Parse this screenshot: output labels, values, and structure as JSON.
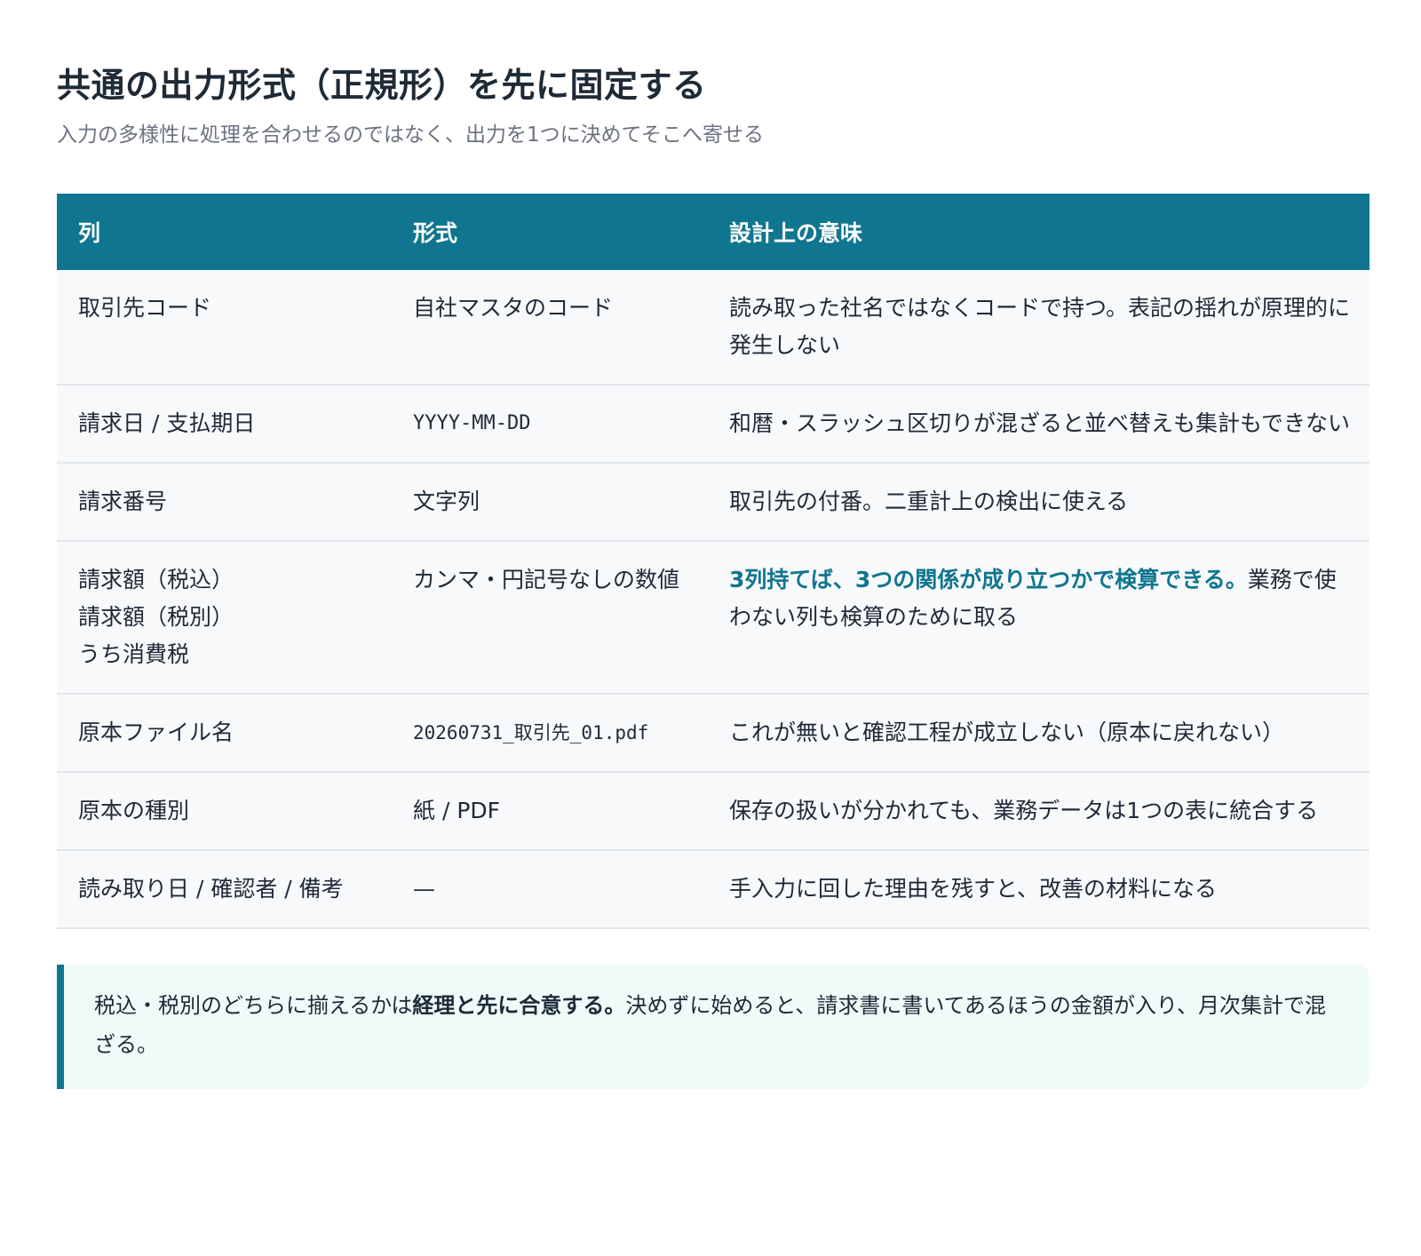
{
  "header": {
    "title": "共通の出力形式（正規形）を先に固定する",
    "subtitle": "入力の多様性に処理を合わせるのではなく、出力を1つに決めてそこへ寄せる"
  },
  "table": {
    "columns": [
      "列",
      "形式",
      "設計上の意味"
    ],
    "rows": [
      {
        "col": [
          "取引先コード"
        ],
        "format": "自社マスタのコード",
        "meaning_accent": "",
        "meaning": "読み取った社名ではなくコードで持つ。表記の揺れが原理的に発生しない"
      },
      {
        "col": [
          "請求日 / 支払期日"
        ],
        "format": "YYYY-MM-DD",
        "meaning_accent": "",
        "meaning": "和暦・スラッシュ区切りが混ざると並べ替えも集計もできない"
      },
      {
        "col": [
          "請求番号"
        ],
        "format": "文字列",
        "meaning_accent": "",
        "meaning": "取引先の付番。二重計上の検出に使える"
      },
      {
        "col": [
          "請求額（税込）",
          "請求額（税別）",
          "うち消費税"
        ],
        "format": "カンマ・円記号なしの数値",
        "meaning_accent": "3列持てば、3つの関係が成り立つかで検算できる。",
        "meaning": "業務で使わない列も検算のために取る"
      },
      {
        "col": [
          "原本ファイル名"
        ],
        "format": "20260731_取引先_01.pdf",
        "meaning_accent": "",
        "meaning": "これが無いと確認工程が成立しない（原本に戻れない）"
      },
      {
        "col": [
          "原本の種別"
        ],
        "format": "紙 / PDF",
        "meaning_accent": "",
        "meaning": "保存の扱いが分かれても、業務データは1つの表に統合する"
      },
      {
        "col": [
          "読み取り日 / 確認者 / 備考"
        ],
        "format": "—",
        "meaning_accent": "",
        "meaning": "手入力に回した理由を残すと、改善の材料になる"
      }
    ]
  },
  "note": {
    "before": "税込・税別のどちらに揃えるかは",
    "bold": "経理と先に合意する。",
    "after": "決めずに始めると、請求書に書いてあるほうの金額が入り、月次集計で混ざる。"
  },
  "colors": {
    "accent": "#10768f",
    "row_bg": "#f8f9fb",
    "note_bg": "#effbf8"
  }
}
